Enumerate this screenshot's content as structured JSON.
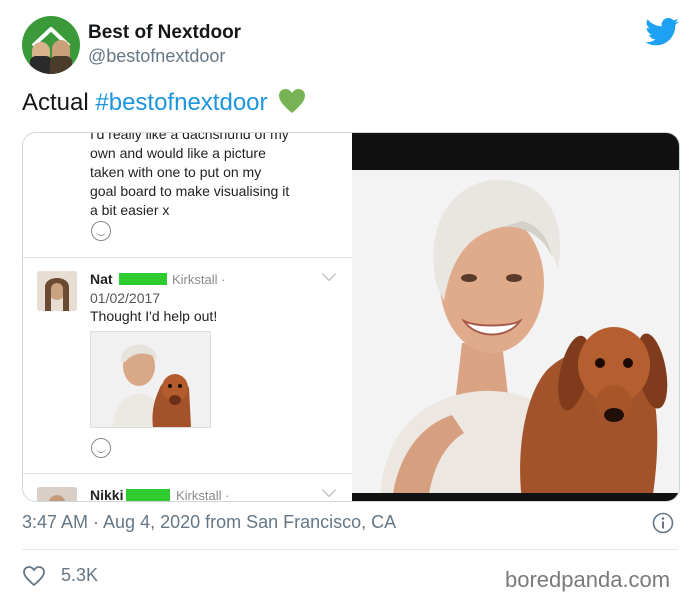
{
  "account": {
    "display_name": "Best of Nextdoor",
    "handle": "@bestofnextdoor"
  },
  "tweet": {
    "text_prefix": "Actual",
    "hashtag": "#bestofnextdoor",
    "emoji": "green-heart-icon"
  },
  "screenshot_thread": {
    "quote_lines": [
      "I'd really like a dachshund of my",
      "own and would like a picture",
      "taken with one to put on my",
      "goal board to make visualising it",
      "a bit easier x"
    ],
    "comments": [
      {
        "name": "Nat",
        "location": "Kirkstall ·",
        "date": "01/02/2017",
        "body": "Thought I'd help out!"
      },
      {
        "name": "Nikki",
        "location": "Kirkstall ·"
      }
    ]
  },
  "footer": {
    "timestamp": "3:47 AM · Aug 4, 2020 from San Francisco, CA",
    "like_count": "5.3K",
    "watermark": "boredpanda.com"
  },
  "colors": {
    "twitter_blue": "#1da1f2",
    "hashtag": "#1b95e0",
    "redaction_green": "#2ecc2e",
    "heart_green": "#77b255"
  }
}
